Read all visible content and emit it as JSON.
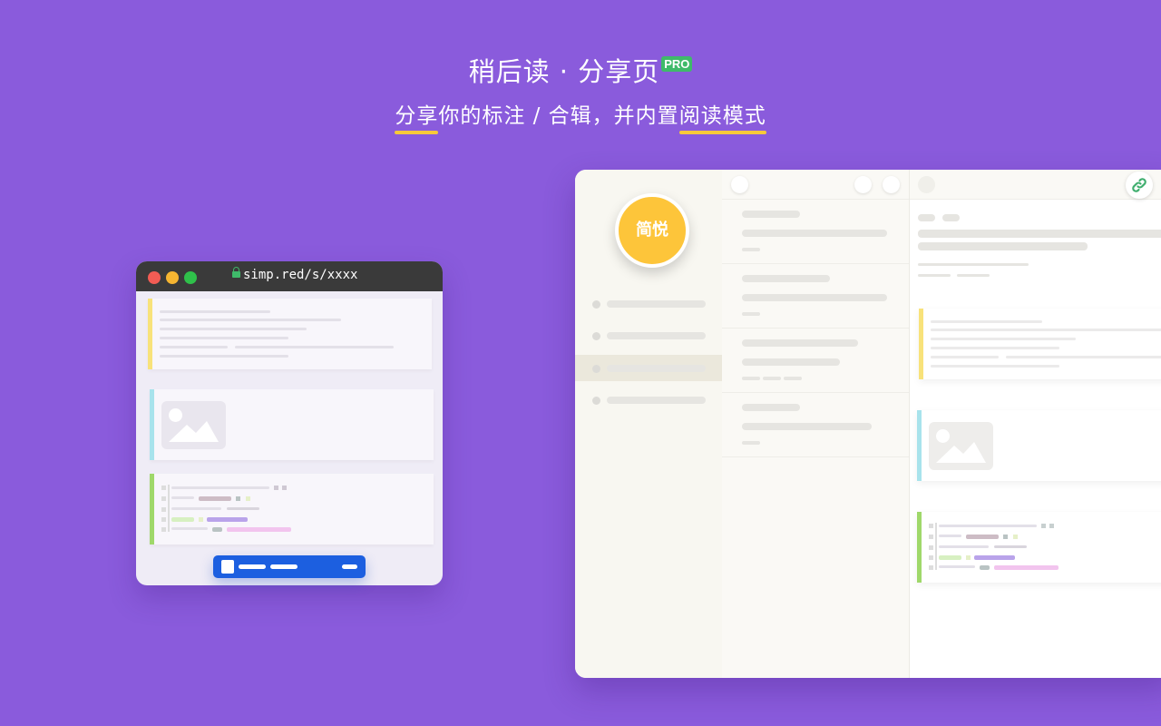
{
  "header": {
    "title": "稍后读 · 分享页",
    "pro_badge": "PRO",
    "subtitle": {
      "part1": "分享",
      "part2": "你的标注 / 合辑，并内置",
      "part3": "阅读",
      "part4": "模式"
    }
  },
  "browser": {
    "url": "simp.red/s/xxxx",
    "traffic_lights": [
      "#f25c54",
      "#f5b531",
      "#2fc04a"
    ],
    "stripe_colors": {
      "text": "#f8e27a",
      "image": "#a8e3ec",
      "code": "#9fd86a"
    }
  },
  "app": {
    "logo_text": "简悦",
    "logo_color": "#fdc53a",
    "link_icon_color": "#3fae6e"
  },
  "colors": {
    "background": "#8a5bdc",
    "underline": "#f7c93a",
    "share_bar": "#1c5fe0"
  }
}
